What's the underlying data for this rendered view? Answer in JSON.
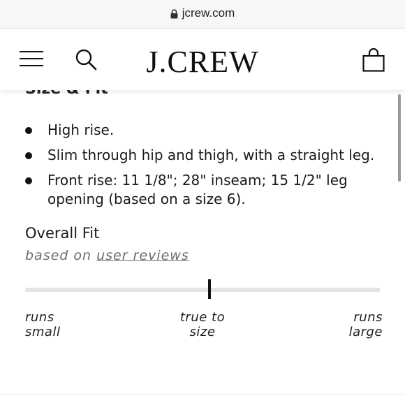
{
  "browser": {
    "url": "jcrew.com"
  },
  "header": {
    "brand": "J.CREW",
    "icons": {
      "menu": "hamburger-menu-icon",
      "search": "search-icon",
      "bag": "shopping-bag-icon"
    }
  },
  "product": {
    "partial_heading": "Size & Fit",
    "bullets": [
      "High rise.",
      "Slim through hip and thigh, with a straight leg.",
      "Front rise: 11 1/8\"; 28\" inseam; 15 1/2\" leg opening (based on a size 6)."
    ]
  },
  "overall_fit": {
    "title": "Overall Fit",
    "sub_prefix": "based on ",
    "sub_link": "user reviews",
    "position_fraction": 0.52,
    "labels": {
      "small": [
        "runs",
        "small"
      ],
      "true": [
        "true to",
        "size"
      ],
      "large": [
        "runs",
        "large"
      ]
    }
  },
  "colors": {
    "marker": "#111111",
    "track": "#e3e3e3",
    "muted_text": "#6b6b6b"
  }
}
